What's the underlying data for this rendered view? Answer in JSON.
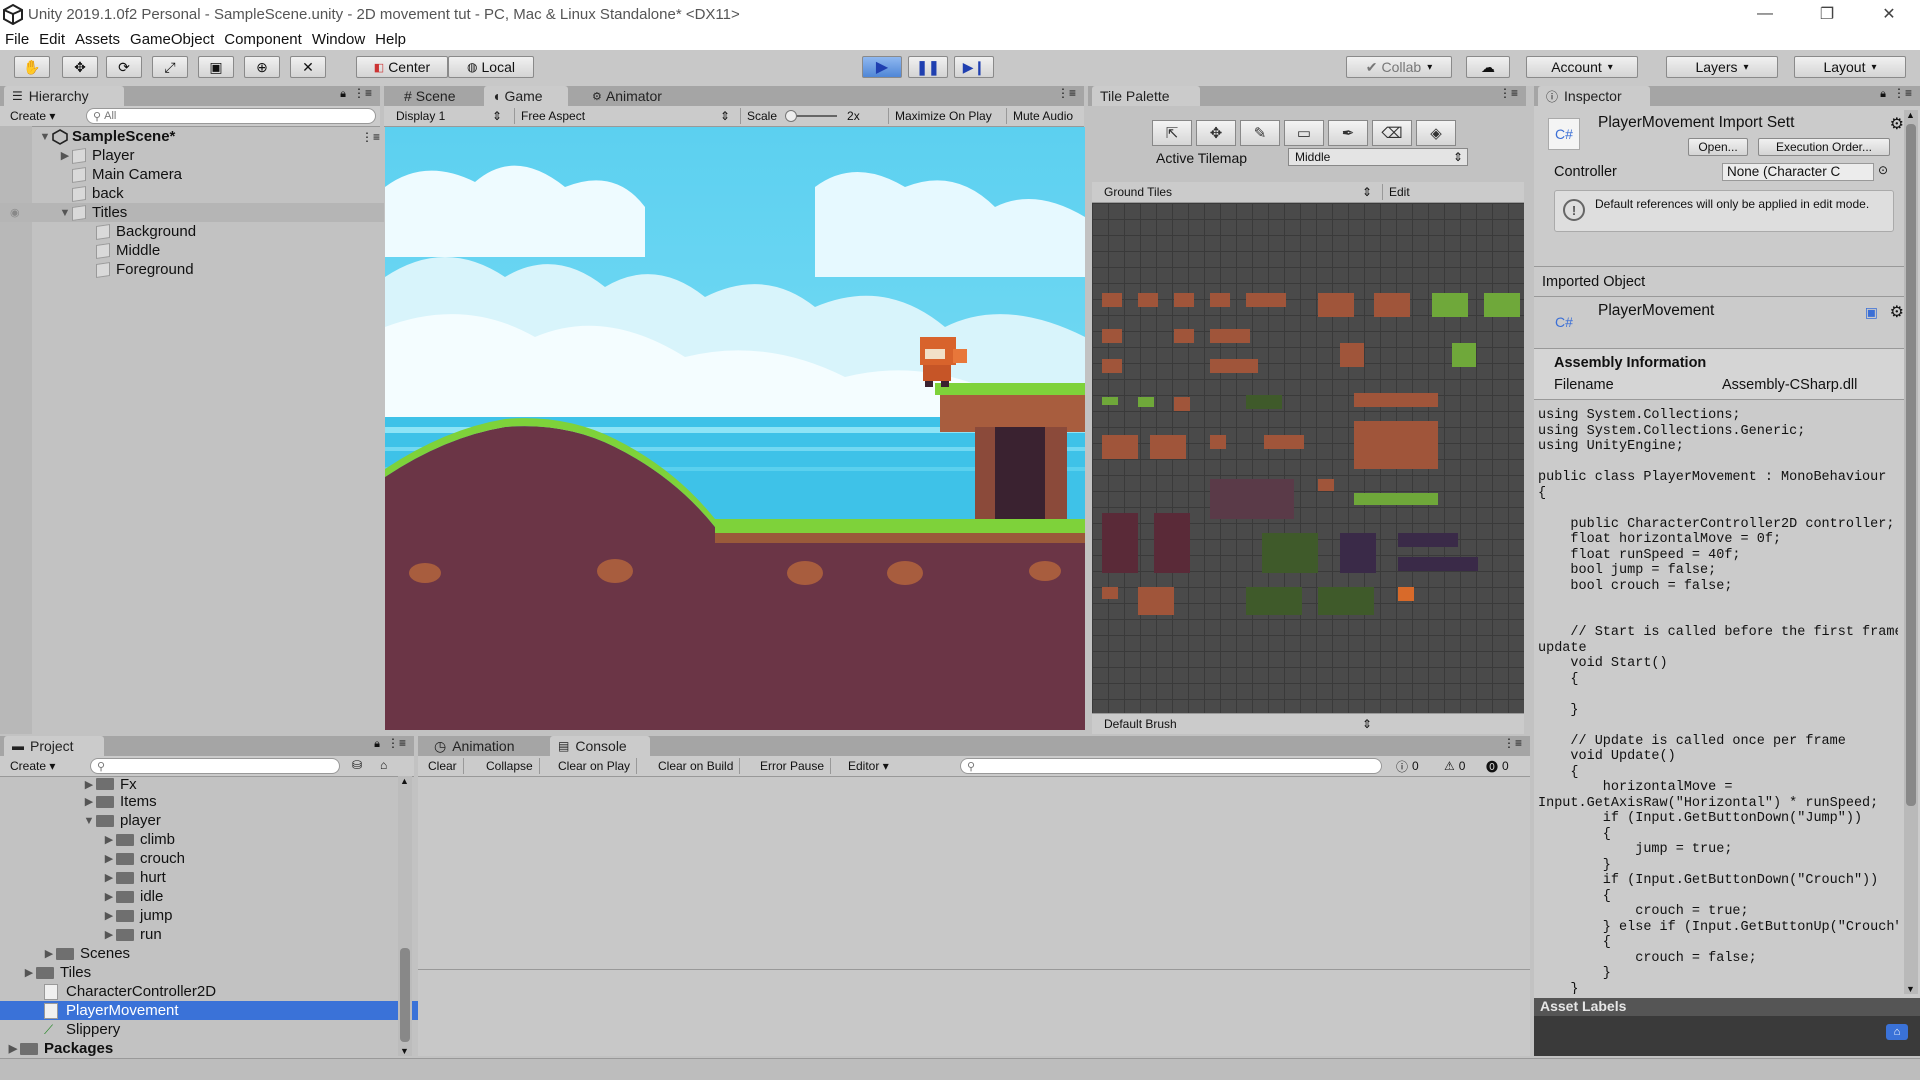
{
  "window": {
    "title": "Unity 2019.1.0f2 Personal - SampleScene.unity - 2D movement tut - PC, Mac & Linux Standalone* <DX11>"
  },
  "menu": [
    "File",
    "Edit",
    "Assets",
    "GameObject",
    "Component",
    "Window",
    "Help"
  ],
  "toolbar": {
    "pivot": "Center",
    "space": "Local",
    "collab": "Collab",
    "account": "Account",
    "layers": "Layers",
    "layout": "Layout"
  },
  "hierarchy": {
    "tab": "Hierarchy",
    "create": "Create",
    "search_placeholder": "All",
    "scene": "SampleScene*",
    "items": [
      "Player",
      "Main Camera",
      "back",
      "Titles",
      "Background",
      "Middle",
      "Foreground"
    ]
  },
  "game": {
    "tabs": [
      "Scene",
      "Game",
      "Animator"
    ],
    "display": "Display 1",
    "aspect": "Free Aspect",
    "scale_label": "Scale",
    "scale_value": "2x",
    "maximize": "Maximize On Play",
    "mute": "Mute Audio"
  },
  "tile_palette": {
    "tab": "Tile Palette",
    "active_tilemap_label": "Active Tilemap",
    "active_tilemap_value": "Middle",
    "palette": "Ground Tiles",
    "edit": "Edit",
    "brush": "Default Brush"
  },
  "inspector": {
    "tab": "Inspector",
    "header_title": "PlayerMovement Import Sett",
    "open": "Open...",
    "execution_order": "Execution Order...",
    "controller_label": "Controller",
    "controller_value": "None (Character C",
    "info_text": "Default references will only be applied in edit mode.",
    "imported_object": "Imported Object",
    "object_name": "PlayerMovement",
    "cs_label": "C#",
    "assembly_header": "Assembly Information",
    "filename_label": "Filename",
    "filename_value": "Assembly-CSharp.dll",
    "code": "using System.Collections;\nusing System.Collections.Generic;\nusing UnityEngine;\n\npublic class PlayerMovement : MonoBehaviour\n{\n\n    public CharacterController2D controller;\n    float horizontalMove = 0f;\n    float runSpeed = 40f;\n    bool jump = false;\n    bool crouch = false;\n\n\n    // Start is called before the first frame\nupdate\n    void Start()\n    {\n\n    }\n\n    // Update is called once per frame\n    void Update()\n    {\n        horizontalMove =\nInput.GetAxisRaw(\"Horizontal\") * runSpeed;\n        if (Input.GetButtonDown(\"Jump\"))\n        {\n            jump = true;\n        }\n        if (Input.GetButtonDown(\"Crouch\"))\n        {\n            crouch = true;\n        } else if (Input.GetButtonUp(\"Crouch\"))\n        {\n            crouch = false;\n        }\n    }",
    "asset_labels": "Asset Labels"
  },
  "project": {
    "tab": "Project",
    "create": "Create",
    "items": [
      "Fx",
      "Items",
      "player",
      "climb",
      "crouch",
      "hurt",
      "idle",
      "jump",
      "run",
      "Scenes",
      "Tiles",
      "CharacterController2D",
      "PlayerMovement",
      "Slippery",
      "Packages"
    ]
  },
  "console": {
    "tabs": [
      "Animation",
      "Console"
    ],
    "buttons": [
      "Clear",
      "Collapse",
      "Clear on Play",
      "Clear on Build",
      "Error Pause",
      "Editor"
    ],
    "counts": [
      "0",
      "0",
      "0"
    ]
  },
  "colors": {
    "selection": "#3a72d8",
    "sky": "#5ed0f0",
    "ground": "#6b3546",
    "grass": "#7ed23a"
  }
}
